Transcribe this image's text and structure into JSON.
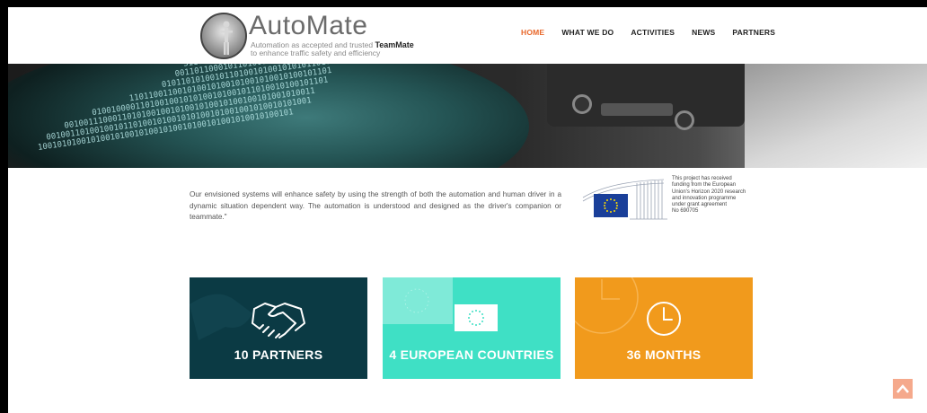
{
  "logo": {
    "title": "AutoMate",
    "subtitle_line1_prefix": "Automation as accepted and trusted ",
    "subtitle_line1_bold": "TeamMate",
    "subtitle_line2": "to enhance traffic safety and efficiency"
  },
  "nav": {
    "items": [
      {
        "label": "HOME",
        "active": true
      },
      {
        "label": "WHAT WE DO",
        "active": false
      },
      {
        "label": "ACTIVITIES",
        "active": false
      },
      {
        "label": "NEWS",
        "active": false
      },
      {
        "label": "PARTNERS",
        "active": false
      }
    ]
  },
  "intro": {
    "text": "Our envisioned systems will enhance safety by using the strength of both the automation and human driver in a dynamic situation dependent way. The automation is understood and designed as the driver's companion or teammate.\""
  },
  "funding": {
    "lines": [
      "This project has received",
      "funding from the European",
      "Union's Horizon 2020 research",
      "and innovation programme",
      "under grant agreement",
      "No 690705"
    ]
  },
  "tiles": [
    {
      "label": "10 PARTNERS",
      "icon": "handshake-icon",
      "color": "#0b3a44"
    },
    {
      "label": "4 EUROPEAN COUNTRIES",
      "icon": "eu-flag-icon",
      "color": "#3fe0c5"
    },
    {
      "label": "36 MONTHS",
      "icon": "clock-icon",
      "color": "#f19a1c"
    }
  ],
  "colors": {
    "accent": "#e8682b",
    "scroll_top": "#f5a98c"
  },
  "scroll_top": {
    "icon": "chevron-up-icon"
  }
}
